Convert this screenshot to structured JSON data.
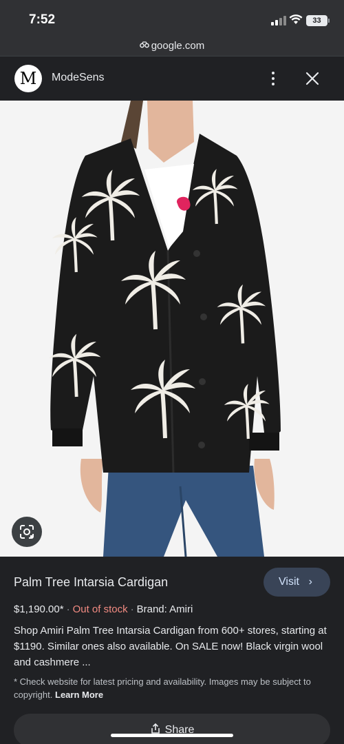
{
  "status_bar": {
    "time": "7:52",
    "battery": "33"
  },
  "browser": {
    "url": "google.com"
  },
  "source": {
    "logo_letter": "M",
    "name": "ModeSens"
  },
  "product": {
    "title": "Palm Tree Intarsia Cardigan",
    "visit_label": "Visit",
    "price": "$1,190.00*",
    "stock_status": "Out of stock",
    "brand": "Brand: Amiri",
    "description": "Shop Amiri Palm Tree Intarsia Cardigan from 600+ stores, starting at $1190. Similar ones also available. On SALE now! Black virgin wool and cashmere ...",
    "disclaimer": "* Check website for latest pricing and availability. Images may be subject to copyright.",
    "learn_more": "Learn More",
    "share_label": "Share"
  },
  "icons": {
    "lock": "lock-icon",
    "more": "more-vert-icon",
    "close": "close-icon",
    "lens": "google-lens-icon",
    "share": "share-icon",
    "chevron": "chevron-right-icon"
  },
  "colors": {
    "background": "#202124",
    "stock_out": "#f28b82",
    "visit_bg": "#394457",
    "visit_text": "#d2e3fc"
  }
}
